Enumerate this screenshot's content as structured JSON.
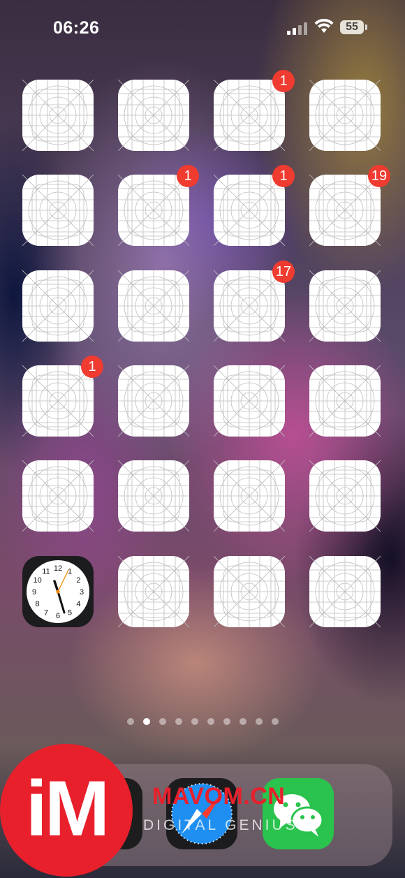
{
  "status_bar": {
    "time": "06:26",
    "battery": "55"
  },
  "badges": {
    "r1c3": "1",
    "r2c2": "1",
    "r2c3": "1",
    "r2c4": "19",
    "r3c3": "17",
    "r4c1": "1"
  },
  "clock": {
    "numbers": [
      "12",
      "1",
      "2",
      "3",
      "4",
      "5",
      "6",
      "7",
      "8",
      "9",
      "10",
      "11"
    ]
  },
  "page_indicator": {
    "total": 10,
    "active": 2
  },
  "dock": {
    "apps": [
      "phone-icon",
      "safari-icon",
      "wechat-icon"
    ]
  },
  "watermark": {
    "logo": "iM",
    "site": "MAVOM.CN",
    "tagline": "DIGITAL GENIUS"
  }
}
